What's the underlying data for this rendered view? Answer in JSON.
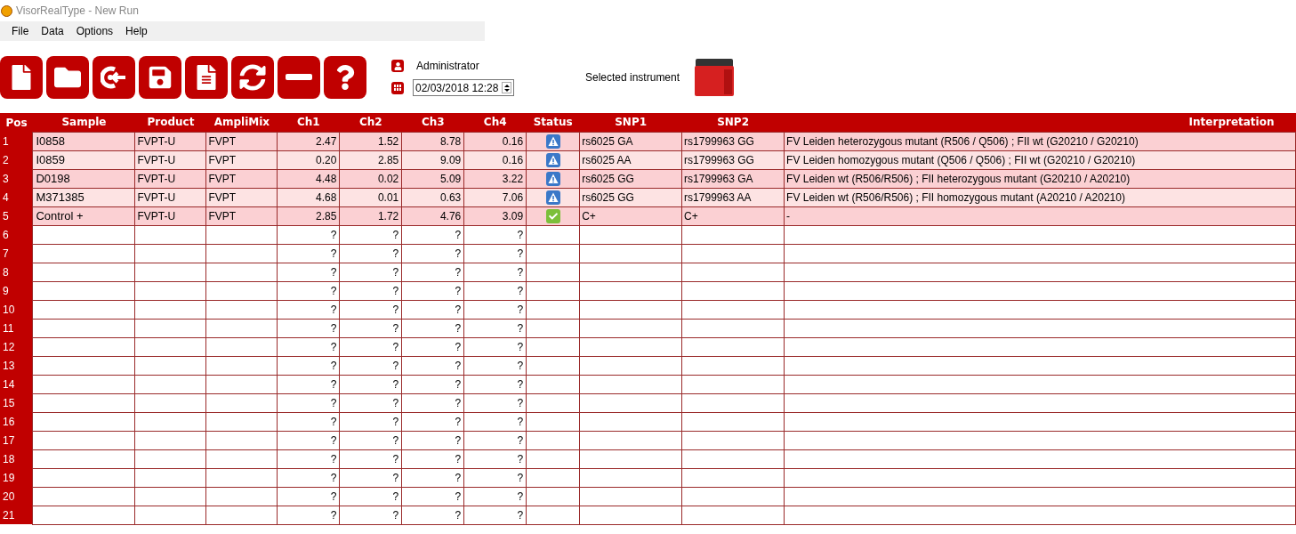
{
  "window": {
    "title": "VisorRealType - New Run"
  },
  "menu": [
    "File",
    "Data",
    "Options",
    "Help"
  ],
  "user": {
    "name": "Administrator"
  },
  "datetime": {
    "value": "02/03/2018 12:28"
  },
  "instrument": {
    "label": "Selected instrument"
  },
  "table": {
    "columns": [
      "Pos",
      "Sample",
      "Product",
      "AmpliMix",
      "Ch1",
      "Ch2",
      "Ch3",
      "Ch4",
      "Status",
      "SNP1",
      "SNP2",
      "Interpretation"
    ],
    "rows": [
      {
        "kind": "warning",
        "cells": [
          "1",
          "I0858",
          "FVPT-U",
          "FVPT",
          "2.47",
          "1.52",
          "8.78",
          "0.16",
          "",
          "rs6025 GA",
          "rs1799963 GG",
          "FV Leiden heterozygous mutant (R506 / Q506) ; FII wt (G20210 / G20210)"
        ]
      },
      {
        "kind": "warning",
        "cells": [
          "2",
          "I0859",
          "FVPT-U",
          "FVPT",
          "0.20",
          "2.85",
          "9.09",
          "0.16",
          "",
          "rs6025 AA",
          "rs1799963 GG",
          "FV Leiden homozygous mutant (Q506 / Q506) ; FII wt (G20210 / G20210)"
        ]
      },
      {
        "kind": "warning",
        "cells": [
          "3",
          "D0198",
          "FVPT-U",
          "FVPT",
          "4.48",
          "0.02",
          "5.09",
          "3.22",
          "",
          "rs6025 GG",
          "rs1799963 GA",
          "FV Leiden wt (R506/R506) ; FII heterozygous mutant (G20210 / A20210)"
        ]
      },
      {
        "kind": "warning",
        "cells": [
          "4",
          "M371385",
          "FVPT-U",
          "FVPT",
          "4.68",
          "0.01",
          "0.63",
          "7.06",
          "",
          "rs6025 GG",
          "rs1799963 AA",
          "FV Leiden wt (R506/R506) ; FII homozygous mutant (A20210 / A20210)"
        ]
      },
      {
        "kind": "ok",
        "cells": [
          "5",
          "Control +",
          "FVPT-U",
          "FVPT",
          "2.85",
          "1.72",
          "4.76",
          "3.09",
          "",
          "C+",
          "C+",
          "-"
        ]
      },
      {
        "kind": "empty",
        "cells": [
          "6",
          "",
          "",
          "",
          "?",
          "?",
          "?",
          "?",
          "",
          "",
          "",
          ""
        ]
      },
      {
        "kind": "empty",
        "cells": [
          "7",
          "",
          "",
          "",
          "?",
          "?",
          "?",
          "?",
          "",
          "",
          "",
          ""
        ]
      },
      {
        "kind": "empty",
        "cells": [
          "8",
          "",
          "",
          "",
          "?",
          "?",
          "?",
          "?",
          "",
          "",
          "",
          ""
        ]
      },
      {
        "kind": "empty",
        "cells": [
          "9",
          "",
          "",
          "",
          "?",
          "?",
          "?",
          "?",
          "",
          "",
          "",
          ""
        ]
      },
      {
        "kind": "empty",
        "cells": [
          "10",
          "",
          "",
          "",
          "?",
          "?",
          "?",
          "?",
          "",
          "",
          "",
          ""
        ]
      },
      {
        "kind": "empty",
        "cells": [
          "11",
          "",
          "",
          "",
          "?",
          "?",
          "?",
          "?",
          "",
          "",
          "",
          ""
        ]
      },
      {
        "kind": "empty",
        "cells": [
          "12",
          "",
          "",
          "",
          "?",
          "?",
          "?",
          "?",
          "",
          "",
          "",
          ""
        ]
      },
      {
        "kind": "empty",
        "cells": [
          "13",
          "",
          "",
          "",
          "?",
          "?",
          "?",
          "?",
          "",
          "",
          "",
          ""
        ]
      },
      {
        "kind": "empty",
        "cells": [
          "14",
          "",
          "",
          "",
          "?",
          "?",
          "?",
          "?",
          "",
          "",
          "",
          ""
        ]
      },
      {
        "kind": "empty",
        "cells": [
          "15",
          "",
          "",
          "",
          "?",
          "?",
          "?",
          "?",
          "",
          "",
          "",
          ""
        ]
      },
      {
        "kind": "empty",
        "cells": [
          "16",
          "",
          "",
          "",
          "?",
          "?",
          "?",
          "?",
          "",
          "",
          "",
          ""
        ]
      },
      {
        "kind": "empty",
        "cells": [
          "17",
          "",
          "",
          "",
          "?",
          "?",
          "?",
          "?",
          "",
          "",
          "",
          ""
        ]
      },
      {
        "kind": "empty",
        "cells": [
          "18",
          "",
          "",
          "",
          "?",
          "?",
          "?",
          "?",
          "",
          "",
          "",
          ""
        ]
      },
      {
        "kind": "empty",
        "cells": [
          "19",
          "",
          "",
          "",
          "?",
          "?",
          "?",
          "?",
          "",
          "",
          "",
          ""
        ]
      },
      {
        "kind": "empty",
        "cells": [
          "20",
          "",
          "",
          "",
          "?",
          "?",
          "?",
          "?",
          "",
          "",
          "",
          ""
        ]
      },
      {
        "kind": "empty",
        "cells": [
          "21",
          "",
          "",
          "",
          "?",
          "?",
          "?",
          "?",
          "",
          "",
          "",
          ""
        ]
      }
    ]
  }
}
